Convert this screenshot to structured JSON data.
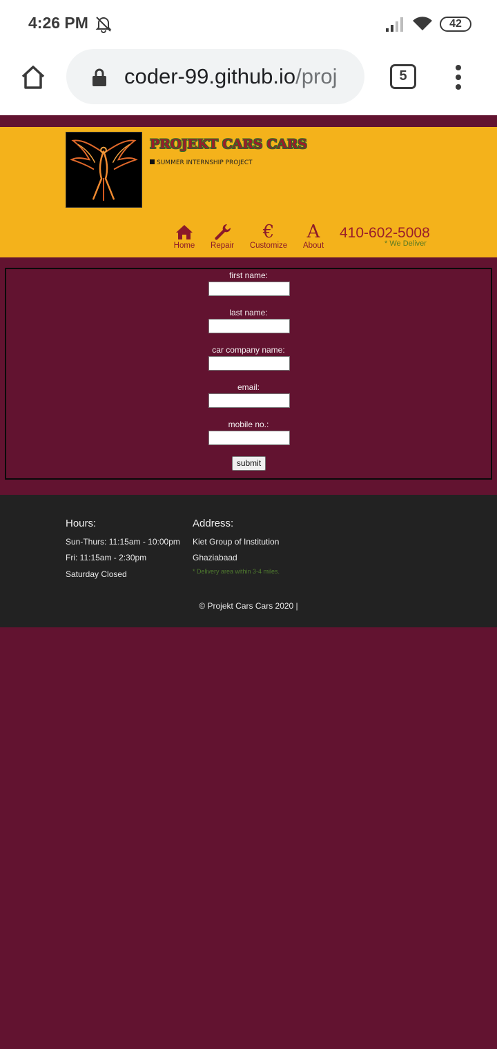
{
  "status_bar": {
    "time": "4:26 PM",
    "battery": "42",
    "icons": [
      "muted-bell-icon",
      "signal-icon",
      "wifi-icon",
      "battery-icon"
    ]
  },
  "browser": {
    "url_host": "coder-99.github.io",
    "url_path": "/proj",
    "tab_count": "5",
    "icons": [
      "home-icon",
      "lock-icon",
      "tabs-icon",
      "overflow-menu-icon"
    ]
  },
  "header": {
    "title": "PROJEKT CARS CARS",
    "subtitle": "SUMMER INTERNSHIP PROJECT",
    "logo": "phoenix-logo",
    "nav": [
      {
        "label": "Home",
        "icon": "home-icon"
      },
      {
        "label": "Repair",
        "icon": "wrench-icon"
      },
      {
        "label": "Customize",
        "icon": "euro-icon",
        "glyph": "€"
      },
      {
        "label": "About",
        "icon": "letter-a-icon",
        "glyph": "A"
      }
    ],
    "phone": "410-602-5008",
    "deliver_note": "* We Deliver"
  },
  "form": {
    "fields": [
      {
        "label": "first name:",
        "value": ""
      },
      {
        "label": "last name:",
        "value": ""
      },
      {
        "label": "car company name:",
        "value": ""
      },
      {
        "label": "email:",
        "value": ""
      },
      {
        "label": "mobile no.:",
        "value": ""
      }
    ],
    "submit_label": "submit"
  },
  "footer": {
    "hours_heading": "Hours:",
    "hours": [
      "Sun-Thurs: 11:15am - 10:00pm",
      "Fri: 11:15am - 2:30pm",
      "Saturday Closed"
    ],
    "address_heading": "Address:",
    "address": [
      "Kiet Group of Institution",
      "Ghaziabaad"
    ],
    "delivery_note": "* Delivery area within 3-4 miles.",
    "copyright": "© Projekt Cars Cars 2020 |"
  },
  "colors": {
    "page_bg": "#621330",
    "header_bg": "#f4b21b",
    "footer_bg": "#222222",
    "accent": "#9a1e2a",
    "note_green": "#5a7a22"
  }
}
